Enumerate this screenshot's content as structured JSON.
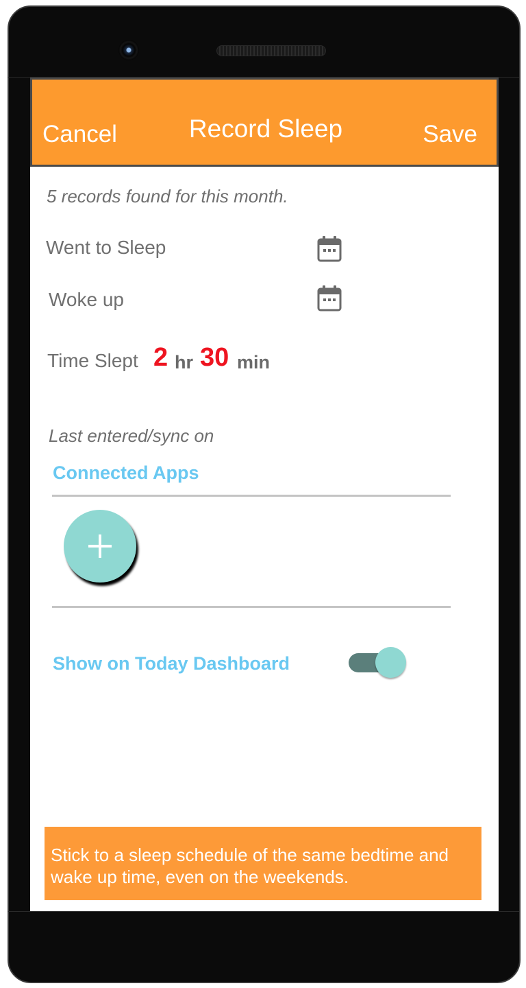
{
  "header": {
    "cancel_label": "Cancel",
    "title": "Record Sleep",
    "save_label": "Save"
  },
  "records_info": "5 records found for this month.",
  "fields": {
    "went_to_sleep_label": "Went to Sleep",
    "woke_up_label": "Woke up"
  },
  "time_slept": {
    "label": "Time Slept",
    "hours": "2",
    "hours_unit": "hr",
    "minutes": "30",
    "minutes_unit": "min"
  },
  "last_sync_label": "Last entered/sync on",
  "connected_apps_label": "Connected Apps",
  "show_on_dashboard": {
    "label": "Show on Today Dashboard",
    "enabled": true
  },
  "tip_text": "Stick to a sleep schedule of the same bedtime and wake up time, even on the weekends.",
  "icons": {
    "calendar": "calendar-icon",
    "add": "plus-icon"
  },
  "colors": {
    "header_bg": "#fd9a2e",
    "accent_text": "#69c8f1",
    "time_value": "#ee1420",
    "fab": "#8fd8d2",
    "toggle_track": "#5b7f7b",
    "tip_bg": "#fd9a38"
  }
}
